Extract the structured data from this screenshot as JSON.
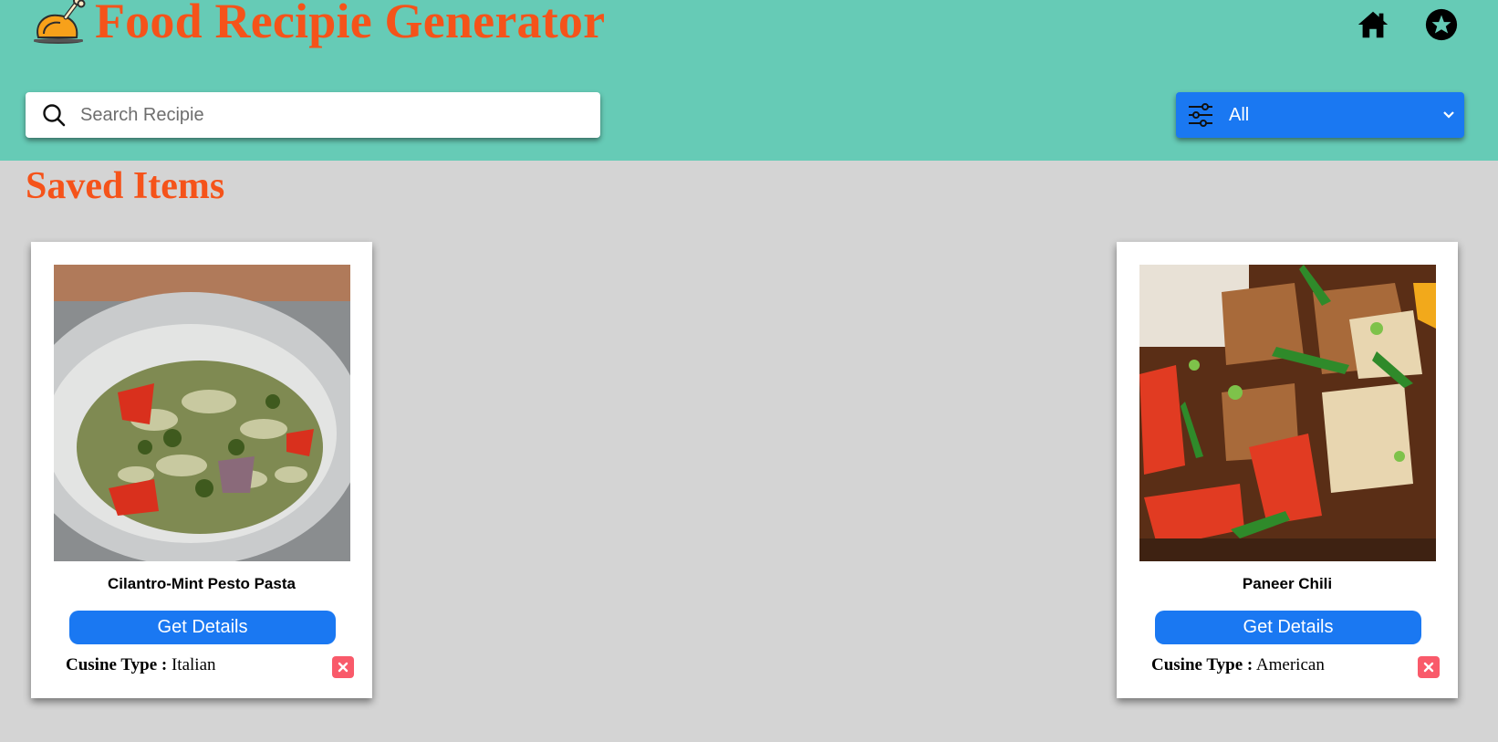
{
  "header": {
    "brand_title": "Food Recipie Generator",
    "brand_icon": "roast-chicken-icon",
    "nav_icons": [
      "home-icon",
      "star-badge-icon"
    ]
  },
  "search": {
    "placeholder": "Search Recipie",
    "value": ""
  },
  "filter": {
    "selected": "All",
    "icon": "sliders-icon"
  },
  "section": {
    "title": "Saved Items"
  },
  "cards": [
    {
      "name": "Cilantro-Mint Pesto Pasta",
      "button_label": "Get Details",
      "cuisine_label": "Cusine Type :",
      "cuisine_value": "Italian"
    },
    {
      "name": "Paneer Chili",
      "button_label": "Get Details",
      "cuisine_label": "Cusine Type :",
      "cuisine_value": "American"
    }
  ],
  "colors": {
    "header_bg": "#66cbb6",
    "accent_orange": "#f5531a",
    "primary_blue": "#1a78f2",
    "remove_red": "#f95a6a",
    "page_bg": "#d4d4d4"
  }
}
